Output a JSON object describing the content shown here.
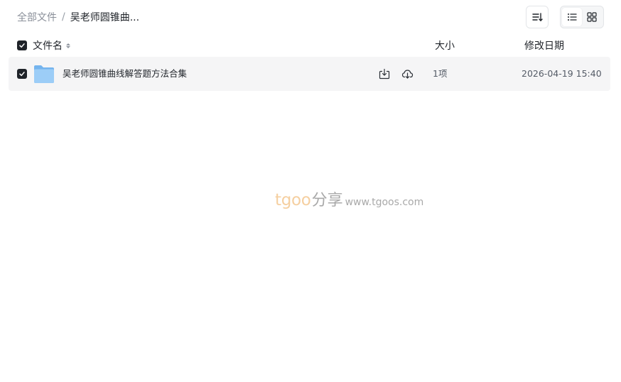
{
  "breadcrumb": {
    "root": "全部文件",
    "separator": "/",
    "current": "吴老师圆锥曲..."
  },
  "toolbar": {
    "sort_icon": "sort-list-icon",
    "view_list_icon": "list-view-icon",
    "view_grid_icon": "grid-view-icon",
    "active_view": "list"
  },
  "columns": {
    "name": "文件名",
    "size": "大小",
    "modified": "修改日期"
  },
  "files": [
    {
      "name": "吴老师圆锥曲线解答题方法合集",
      "type": "folder",
      "size": "1项",
      "modified": "2026-04-19 15:40",
      "selected": true
    }
  ],
  "watermark": {
    "brand": "tgoo",
    "cn": "分享",
    "url": "www.tgoos.com"
  },
  "colors": {
    "checkbox": "#1f2329",
    "row_bg": "#f5f5f6",
    "folder": "#8ec5f5",
    "watermark_brand": "#f5cfa0"
  }
}
